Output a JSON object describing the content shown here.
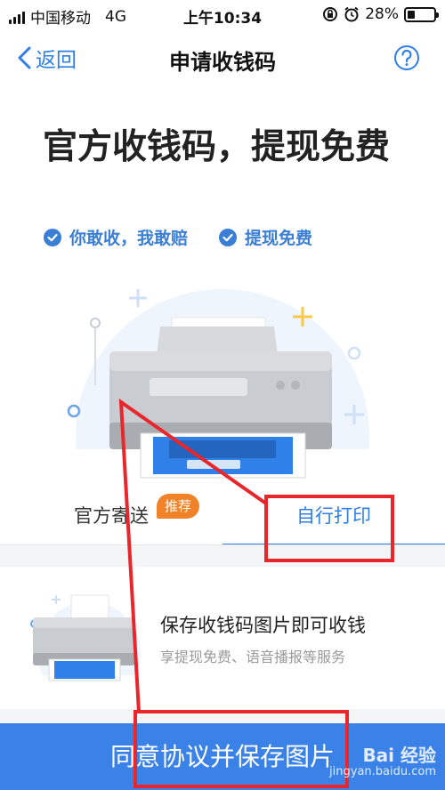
{
  "status_bar": {
    "carrier": "中国移动",
    "network": "4G",
    "time": "上午10:34",
    "battery": "28%",
    "battery_level": 0.28
  },
  "nav": {
    "back_label": "返回",
    "title": "申请收钱码"
  },
  "hero": {
    "title": "官方收钱码，提现免费",
    "features": [
      "你敢收，我敢赔",
      "提现免费"
    ]
  },
  "tabs": [
    {
      "label": "官方寄送",
      "active": false
    },
    {
      "label": "自行打印",
      "active": true
    }
  ],
  "badge": "推荐",
  "option": {
    "title": "保存收钱码图片即可收钱",
    "subtitle": "享提现免费、语音播报等服务"
  },
  "primary_button": "同意协议并保存图片",
  "watermark": {
    "brand": "Bai 经验",
    "site": "jingyan.baidu.com"
  },
  "colors": {
    "accent": "#2f7fe6",
    "button": "#3b82e8",
    "badge": "#f0832a",
    "annotation": "#e8262b"
  }
}
